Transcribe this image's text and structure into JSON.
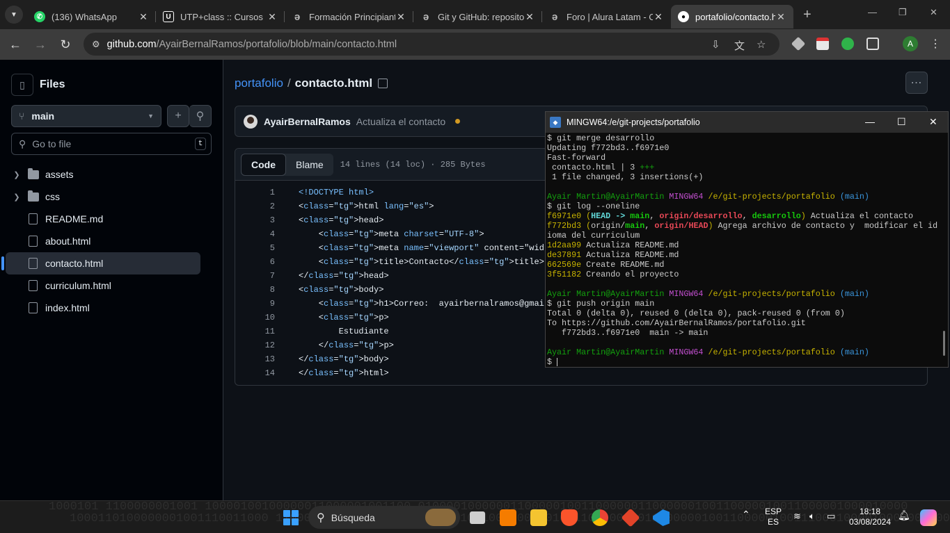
{
  "browser": {
    "tabs": [
      {
        "label": "(136) WhatsApp",
        "icon": "whatsapp-icon",
        "color": "#25d366"
      },
      {
        "label": "UTP+class :: Cursos",
        "icon": "utp-icon",
        "color": "#ffffff"
      },
      {
        "label": "Formación Principiante",
        "icon": "alura-icon",
        "color": "#1f1f1f"
      },
      {
        "label": "Git y GitHub: reposito",
        "icon": "alura-icon",
        "color": "#1f1f1f"
      },
      {
        "label": "Foro | Alura Latam - C",
        "icon": "alura-icon",
        "color": "#1f1f1f"
      },
      {
        "label": "portafolio/contacto.h",
        "icon": "github-icon",
        "color": "#ffffff"
      }
    ],
    "url_host": "github.com",
    "url_path": "/AyairBernalRamos/portafolio/blob/main/contacto.html",
    "profile_initial": "A"
  },
  "sidebar": {
    "title": "Files",
    "branch": "main",
    "goto_placeholder": "Go to file",
    "goto_shortcut": "t",
    "items": [
      {
        "label": "assets",
        "type": "folder"
      },
      {
        "label": "css",
        "type": "folder"
      },
      {
        "label": "README.md",
        "type": "file"
      },
      {
        "label": "about.html",
        "type": "file"
      },
      {
        "label": "contacto.html",
        "type": "file",
        "selected": true
      },
      {
        "label": "curriculum.html",
        "type": "file"
      },
      {
        "label": "index.html",
        "type": "file"
      }
    ]
  },
  "main": {
    "repo": "portafolio",
    "separator": "/",
    "file": "contacto.html",
    "commit_author": "AyairBernalRamos",
    "commit_message": "Actualiza el contacto",
    "tab_code": "Code",
    "tab_blame": "Blame",
    "lines_info": "14 lines (14 loc) · 285 Bytes",
    "code_lines": [
      "<!DOCTYPE html>",
      "<html lang=\"es\">",
      "<head>",
      "    <meta charset=\"UTF-8\">",
      "    <meta name=\"viewport\" content=\"width=device-width,",
      "    <title>Contacto</title>",
      "</head>",
      "<body>",
      "    <h1>Correo:  ayairbernalramos@gmail.com</h1>",
      "    <p>",
      "        Estudiante",
      "    </p>",
      "</body>",
      "</html>"
    ]
  },
  "terminal": {
    "title": "MINGW64:/e/git-projects/portafolio",
    "lines": [
      "$ git merge desarrollo",
      "Updating f772bd3..f6971e0",
      "Fast-forward",
      " contacto.html | 3 +++",
      " 1 file changed, 3 insertions(+)",
      "",
      "Ayair Martin@AyairMartin MINGW64 /e/git-projects/portafolio (main)",
      "$ git log --oneline",
      "f6971e0 (HEAD -> main, origin/desarrollo, desarrollo) Actualiza el contacto",
      "f772bd3 (origin/main, origin/HEAD) Agrega archivo de contacto y  modificar el id",
      "ioma del curriculum",
      "1d2aa99 Actualiza README.md",
      "de37891 Actualiza README.md",
      "662569e Create README.md",
      "3f51182 Creando el proyecto",
      "",
      "Ayair Martin@AyairMartin MINGW64 /e/git-projects/portafolio (main)",
      "$ git push origin main",
      "Total 0 (delta 0), reused 0 (delta 0), pack-reused 0 (from 0)",
      "To https://github.com/AyairBernalRamos/portafolio.git",
      "   f772bd3..f6971e0  main -> main",
      "",
      "Ayair Martin@AyairMartin MINGW64 /e/git-projects/portafolio (main)",
      "$ "
    ]
  },
  "taskbar": {
    "search_label": "Búsqueda",
    "lang_top": "ESP",
    "lang_bottom": "ES",
    "time": "18:18",
    "date": "03/08/2024",
    "binary_row1": "1000101 1100000001001   10000100100000011000001001100   010000100000011000001001100000011000000100110000010011000001000010000",
    "binary_row2": "1000110100000001001110011000   1100000100110000010011100010   1000100000100110000010011000000100110000010011100010000100000011000"
  },
  "colors": {
    "accent": "#4493f8",
    "bg": "#0d1117",
    "terminal_bg": "#0c0c0c"
  }
}
